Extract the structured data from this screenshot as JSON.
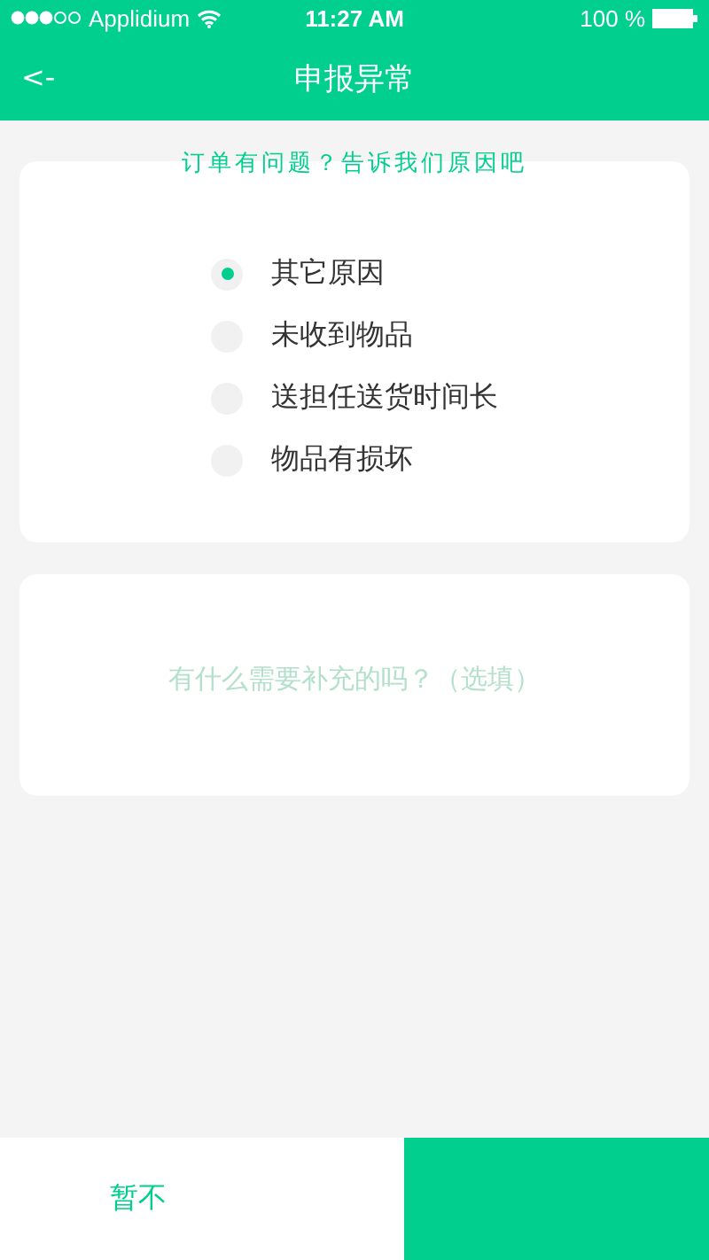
{
  "status_bar": {
    "carrier": "Applidium",
    "time": "11:27 AM",
    "battery": "100 %"
  },
  "nav_bar": {
    "back": "<-",
    "title": "申报异常"
  },
  "reason_card": {
    "heading": "订单有问题？告诉我们原因吧",
    "options": [
      {
        "label": "其它原因",
        "selected": true
      },
      {
        "label": "未收到物品",
        "selected": false
      },
      {
        "label": "送担任送货时间长",
        "selected": false
      },
      {
        "label": "物品有损坏",
        "selected": false
      }
    ]
  },
  "note_card": {
    "placeholder": "有什么需要补充的吗？（选填）"
  },
  "bottom_bar": {
    "cancel": "暂不"
  }
}
